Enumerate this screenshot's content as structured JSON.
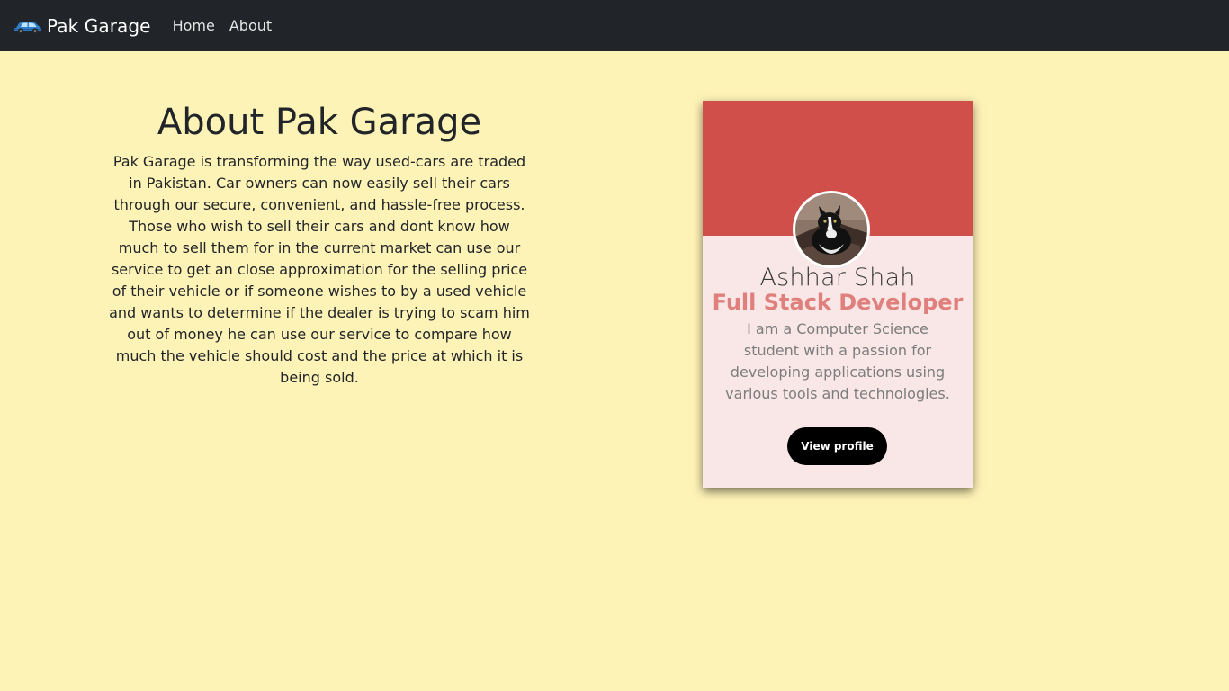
{
  "navbar": {
    "brand_icon": "car-icon",
    "brand_text": "Pak Garage",
    "links": [
      {
        "label": "Home"
      },
      {
        "label": "About"
      }
    ],
    "background": "#212529"
  },
  "about": {
    "title": "About Pak Garage",
    "text": "Pak Garage is transforming the way used-cars are traded in Pakistan. Car owners can now easily sell their cars through our secure, convenient, and hassle-free process. Those who wish to sell their cars and dont know how much to sell them for in the current market can use our service to get an close approximation for the selling price of their vehicle or if someone wishes to by a used vehicle and wants to determine if the dealer is trying to scam him out of money he can use our service to compare how much the vehicle should cost and the price at which it is being sold."
  },
  "profile_card": {
    "avatar_icon": "cat-avatar",
    "name": "Ashhar Shah",
    "role": "Full Stack Developer",
    "description": "I am a Computer Science student with a passion for developing applications using various tools and technologies.",
    "button_label": "View profile",
    "header_color": "#d04f4a",
    "body_color": "#f9e6e6",
    "role_color": "#e0807c"
  },
  "page": {
    "background": "#fef3b6"
  }
}
